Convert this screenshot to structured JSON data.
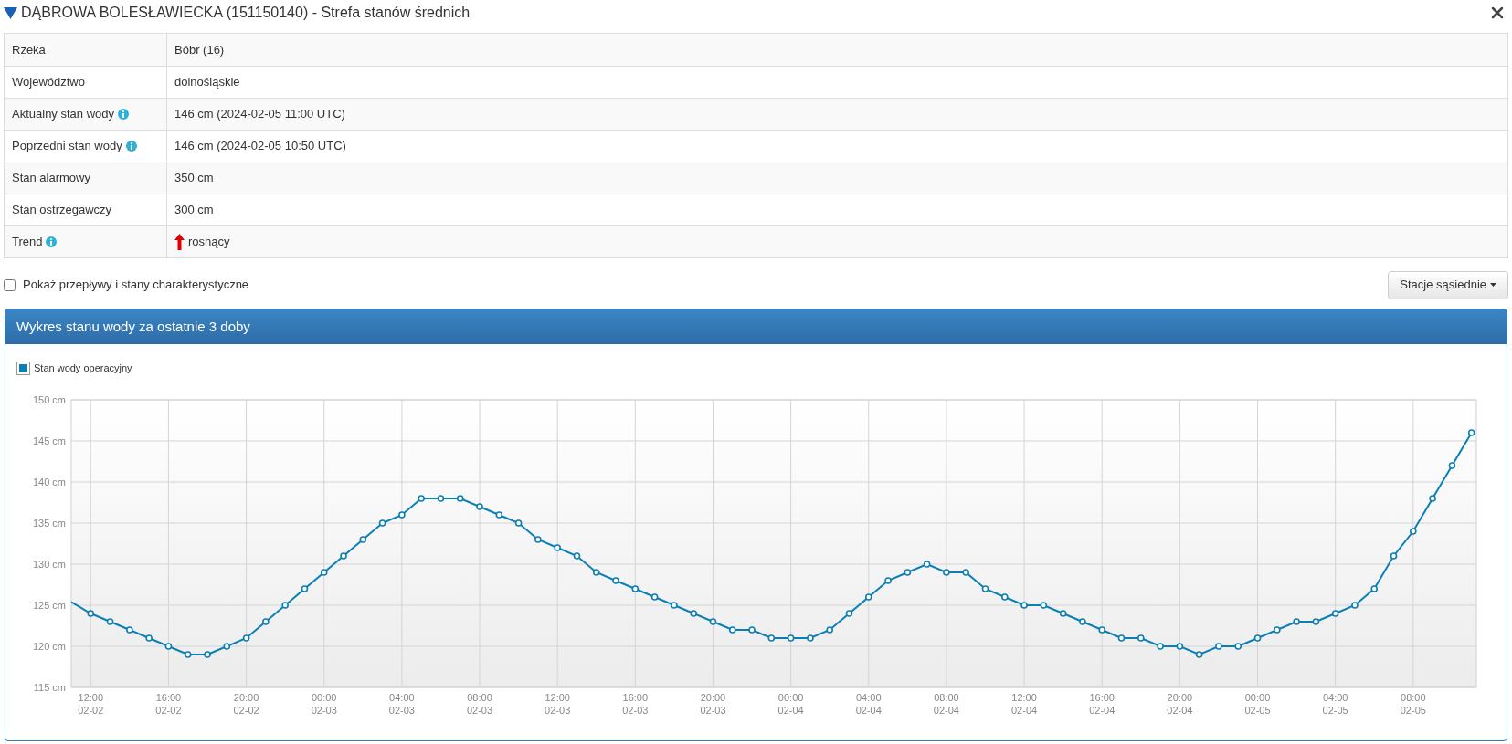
{
  "window": {
    "title": "DĄBROWA BOLESŁAWIECKA (151150140) - Strefa stanów średnich",
    "expanded": true
  },
  "info_table": {
    "rows": [
      {
        "label": "Rzeka",
        "info": false,
        "value": "Bóbr (16)"
      },
      {
        "label": "Województwo",
        "info": false,
        "value": "dolnośląskie"
      },
      {
        "label": "Aktualny stan wody",
        "info": true,
        "value": "146 cm (2024-02-05 11:00 UTC)"
      },
      {
        "label": "Poprzedni stan wody",
        "info": true,
        "value": "146 cm (2024-02-05 10:50 UTC)"
      },
      {
        "label": "Stan alarmowy",
        "info": false,
        "value": "350 cm"
      },
      {
        "label": "Stan ostrzegawczy",
        "info": false,
        "value": "300 cm"
      },
      {
        "label": "Trend",
        "info": true,
        "value": "rosnący",
        "rising": true
      }
    ]
  },
  "options": {
    "checkbox": {
      "label": "Pokaż przepływy i stany charakterystyczne",
      "checked": false
    },
    "dropdown_button": {
      "label": "Stacje sąsiednie"
    }
  },
  "chart_panel": {
    "title": "Wykres stanu wody za ostatnie 3 doby",
    "chart_data": {
      "type": "line",
      "categories": [
        null,
        "12:00\n02-02",
        null,
        null,
        null,
        "16:00\n02-02",
        null,
        null,
        null,
        "20:00\n02-02",
        null,
        null,
        null,
        "00:00\n02-03",
        null,
        null,
        null,
        "04:00\n02-03",
        null,
        null,
        null,
        "08:00\n02-03",
        null,
        null,
        null,
        "12:00\n02-03",
        null,
        null,
        null,
        "16:00\n02-03",
        null,
        null,
        null,
        "20:00\n02-03",
        null,
        null,
        null,
        "00:00\n02-04",
        null,
        null,
        null,
        "04:00\n02-04",
        null,
        null,
        null,
        "08:00\n02-04",
        null,
        null,
        null,
        "12:00\n02-04",
        null,
        null,
        null,
        "16:00\n02-04",
        null,
        null,
        null,
        "20:00\n02-04",
        null,
        null,
        null,
        "00:00\n02-05",
        null,
        null,
        null,
        "04:00\n02-05",
        null,
        null,
        null,
        "08:00\n02-05",
        null,
        null,
        null
      ],
      "series": [
        {
          "name": "Stan wody operacyjny",
          "color": "#0b7fb5",
          "marker": true,
          "values": [
            125.4,
            124,
            123,
            122,
            121,
            120,
            119,
            119,
            120,
            121,
            123,
            125,
            127,
            129,
            131,
            133,
            135,
            136,
            138,
            138,
            138,
            137,
            136,
            135,
            133,
            132,
            131,
            129,
            128,
            127,
            126,
            125,
            124,
            123,
            122,
            122,
            121,
            121,
            121,
            122,
            124,
            126,
            128,
            129,
            130,
            129,
            129,
            127,
            126,
            125,
            125,
            124,
            123,
            122,
            121,
            121,
            120,
            120,
            119,
            120,
            120,
            121,
            122,
            123,
            123,
            124,
            125,
            127,
            131,
            134,
            138,
            142,
            146
          ]
        }
      ],
      "grid": true,
      "ylim": [
        115,
        150
      ],
      "yticks": [
        {
          "value": 115,
          "label": "115 cm"
        },
        {
          "value": 120,
          "label": "120 cm"
        },
        {
          "value": 125,
          "label": "125 cm"
        },
        {
          "value": 130,
          "label": "130 cm"
        },
        {
          "value": 135,
          "label": "135 cm"
        },
        {
          "value": 140,
          "label": "140 cm"
        },
        {
          "value": 145,
          "label": "145 cm"
        },
        {
          "value": 150,
          "label": "150 cm"
        }
      ]
    }
  }
}
